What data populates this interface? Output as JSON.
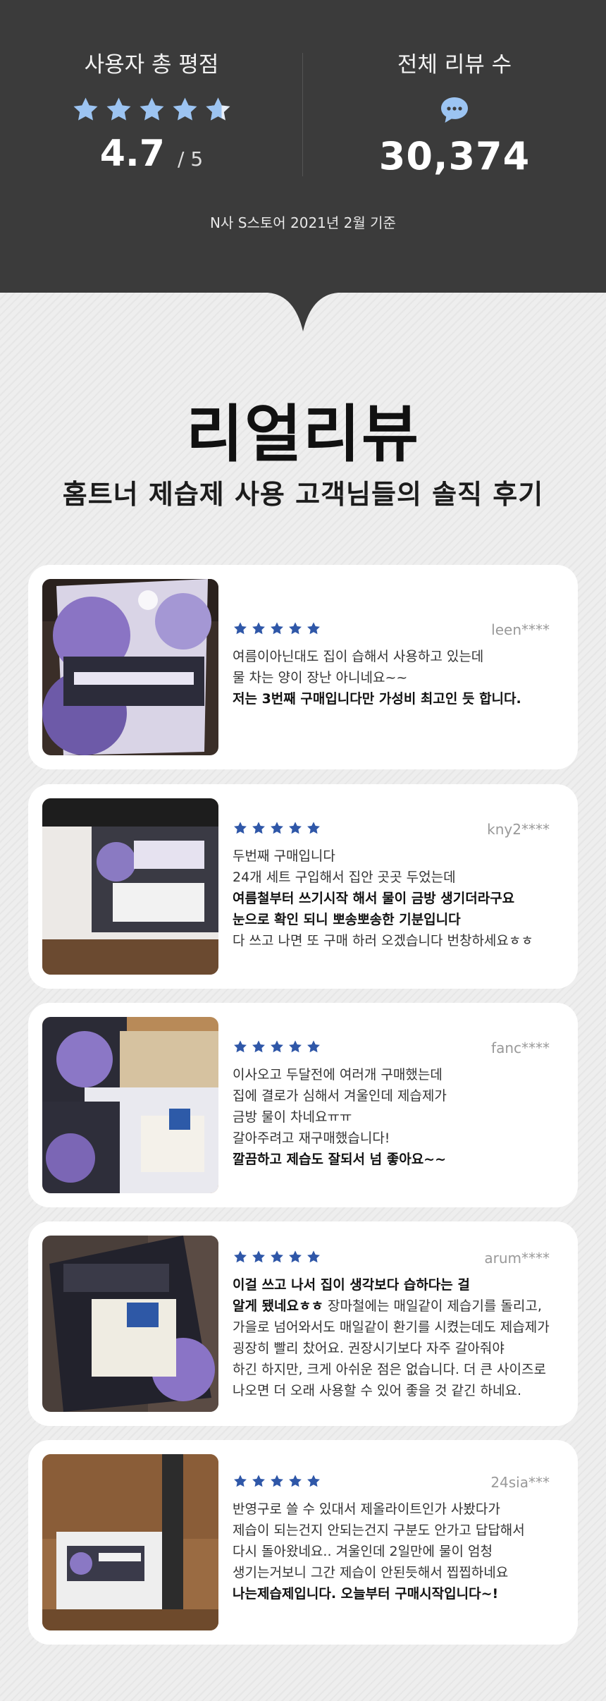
{
  "summary": {
    "rating_title": "사용자 총 평점",
    "rating_value": "4.7",
    "rating_max": "/ 5",
    "rating_stars": 4.7,
    "reviews_title": "전체 리뷰 수",
    "reviews_count": "30,374",
    "basis": "N사 S스토어 2021년 2월 기준"
  },
  "headline": "리얼리뷰",
  "subtitle": "홈트너 제습제 사용 고객님들의 솔직 후기",
  "colors": {
    "star_light": "#9cc4f2",
    "star_dark": "#2f57a8",
    "dark_bg": "#3b3b3b"
  },
  "reviews": [
    {
      "user": "leen****",
      "stars": 5,
      "lines": [
        {
          "text": "여름이아닌대도 집이 습해서 사용하고 있는데",
          "bold": false
        },
        {
          "text": "물 차는 양이 장난 아니네요~~",
          "bold": false
        },
        {
          "text": "저는 3번째 구매입니다만 가성비 최고인 듯 합니다.",
          "bold": true
        }
      ]
    },
    {
      "user": "kny2****",
      "stars": 5,
      "lines": [
        {
          "text": "두번째 구매입니다",
          "bold": false
        },
        {
          "text": "24개 세트 구입해서 집안 곳곳 두었는데",
          "bold": false
        },
        {
          "text": "여름철부터 쓰기시작 해서 물이 금방 생기더라구요",
          "bold": true
        },
        {
          "text": "눈으로 확인 되니 뽀송뽀송한 기분입니다",
          "bold": true
        },
        {
          "text": "다 쓰고 나면 또 구매 하러 오겠습니다 번창하세요ㅎㅎ",
          "bold": false
        }
      ]
    },
    {
      "user": "fanc****",
      "stars": 5,
      "lines": [
        {
          "text": "이사오고 두달전에 여러개 구매했는데",
          "bold": false
        },
        {
          "text": "집에 결로가 심해서 겨울인데 제습제가",
          "bold": false
        },
        {
          "text": "금방 물이 차네요ㅠㅠ",
          "bold": false
        },
        {
          "text": "갈아주려고 재구매했습니다!",
          "bold": false
        },
        {
          "text": "깔끔하고 제습도 잘되서 넘 좋아요~~",
          "bold": true
        }
      ]
    },
    {
      "user": "arum****",
      "stars": 5,
      "lines": [
        {
          "text": "이걸 쓰고 나서 집이 생각보다 습하다는 걸",
          "bold": true
        },
        {
          "text": "알게 됐네요ㅎㅎ",
          "bold": true,
          "rest": " 장마철에는 매일같이 제습기를 돌리고,"
        },
        {
          "text": "가을로 넘어와서도 매일같이 환기를 시켰는데도 제습제가",
          "bold": false
        },
        {
          "text": "굉장히 빨리 찼어요. 권장시기보다 자주 갈아줘야",
          "bold": false
        },
        {
          "text": "하긴 하지만, 크게 아쉬운 점은 없습니다. 더 큰 사이즈로",
          "bold": false
        },
        {
          "text": "나오면 더 오래 사용할 수 있어 좋을 것 같긴 하네요.",
          "bold": false
        }
      ]
    },
    {
      "user": "24sia***",
      "stars": 5,
      "lines": [
        {
          "text": "반영구로 쓸 수 있대서 제올라이트인가 사봤다가",
          "bold": false
        },
        {
          "text": "제습이 되는건지 안되는건지 구분도 안가고 답답해서",
          "bold": false
        },
        {
          "text": "다시 돌아왔네요.. 겨울인데 2일만에 물이 엄청",
          "bold": false
        },
        {
          "text": "생기는거보니 그간 제습이 안된듯해서 찝찝하네요",
          "bold": false
        },
        {
          "text": "나는제습제입니다. 오늘부터 구매시작입니다~!",
          "bold": true
        }
      ]
    }
  ]
}
